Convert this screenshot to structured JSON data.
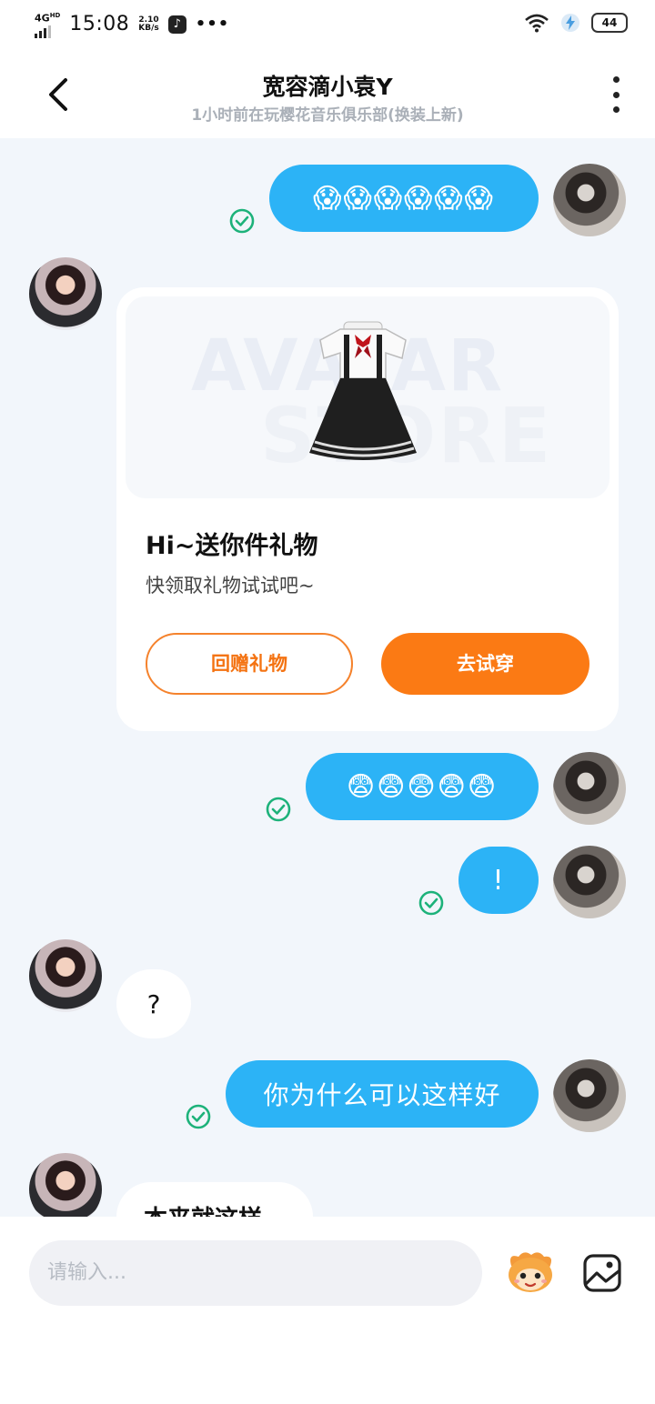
{
  "status_bar": {
    "network": "4G",
    "network_sup": "HD",
    "time": "15:08",
    "speed_value": "2.10",
    "speed_unit": "KB/s",
    "more": "•••",
    "battery": "44"
  },
  "header": {
    "title": "宽容滴小袁Y",
    "subtitle": "1小时前在玩樱花音乐俱乐部(换装上新)"
  },
  "messages": [
    {
      "from": "me",
      "content": "😱😱😱😱😱😱",
      "status": "read"
    },
    {
      "from": "other",
      "type": "gift_card"
    },
    {
      "from": "me",
      "content": "😨😨😨😨😨",
      "status": "read"
    },
    {
      "from": "me",
      "content": "!",
      "status": "read"
    },
    {
      "from": "other",
      "content": "?"
    },
    {
      "from": "me",
      "content": "你为什么可以这样好",
      "status": "read"
    },
    {
      "from": "other",
      "content": "本来就这样"
    }
  ],
  "gift_card": {
    "watermark_line1": "AVATAR",
    "watermark_line2": "STORE",
    "title": "Hi~送你件礼物",
    "subtitle": "快领取礼物试试吧~",
    "return_gift_label": "回赠礼物",
    "try_on_label": "去试穿",
    "accent_color": "#fb7a14"
  },
  "composer": {
    "placeholder": "请输入..."
  },
  "colors": {
    "my_bubble": "#2cb3f6",
    "check": "#1db27a",
    "background": "#f2f6fb"
  }
}
